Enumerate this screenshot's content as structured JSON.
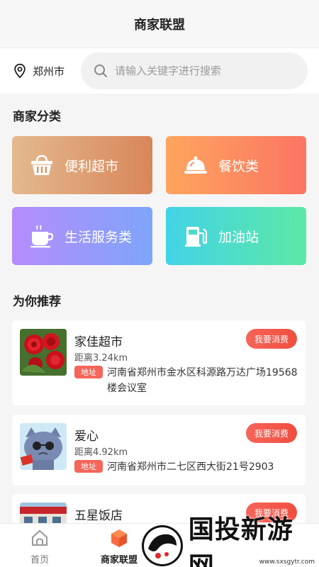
{
  "header": {
    "title": "商家联盟"
  },
  "location": {
    "city": "郑州市"
  },
  "search": {
    "placeholder": "请输入关键字进行搜索"
  },
  "categories_section": {
    "title": "商家分类"
  },
  "categories": [
    {
      "label": "便利超市",
      "icon": "basket-icon"
    },
    {
      "label": "餐饮类",
      "icon": "food-cloche-icon"
    },
    {
      "label": "生活服务类",
      "icon": "coffee-cup-icon"
    },
    {
      "label": "加油站",
      "icon": "fuel-pump-icon"
    }
  ],
  "recommend_section": {
    "title": "为你推荐"
  },
  "merchants": [
    {
      "name": "家佳超市",
      "distance": "距离3.24km",
      "addr_tag": "地址",
      "address": "河南省郑州市金水区科源路万达广场19568楼会议室",
      "action": "我要消费"
    },
    {
      "name": "爱心",
      "distance": "距离4.92km",
      "addr_tag": "地址",
      "address": "河南省郑州市二七区西大街21号2903",
      "action": "我要消费"
    },
    {
      "name": "五星饭店",
      "action": "我要消费"
    }
  ],
  "tabbar": {
    "home": "首页",
    "alliance": "商家联盟"
  },
  "watermark": {
    "text": "国投新游网",
    "url": "www.sxsgytr.com"
  },
  "colors": {
    "accent": "#f5655a",
    "active_tab": "#fb6b40"
  }
}
